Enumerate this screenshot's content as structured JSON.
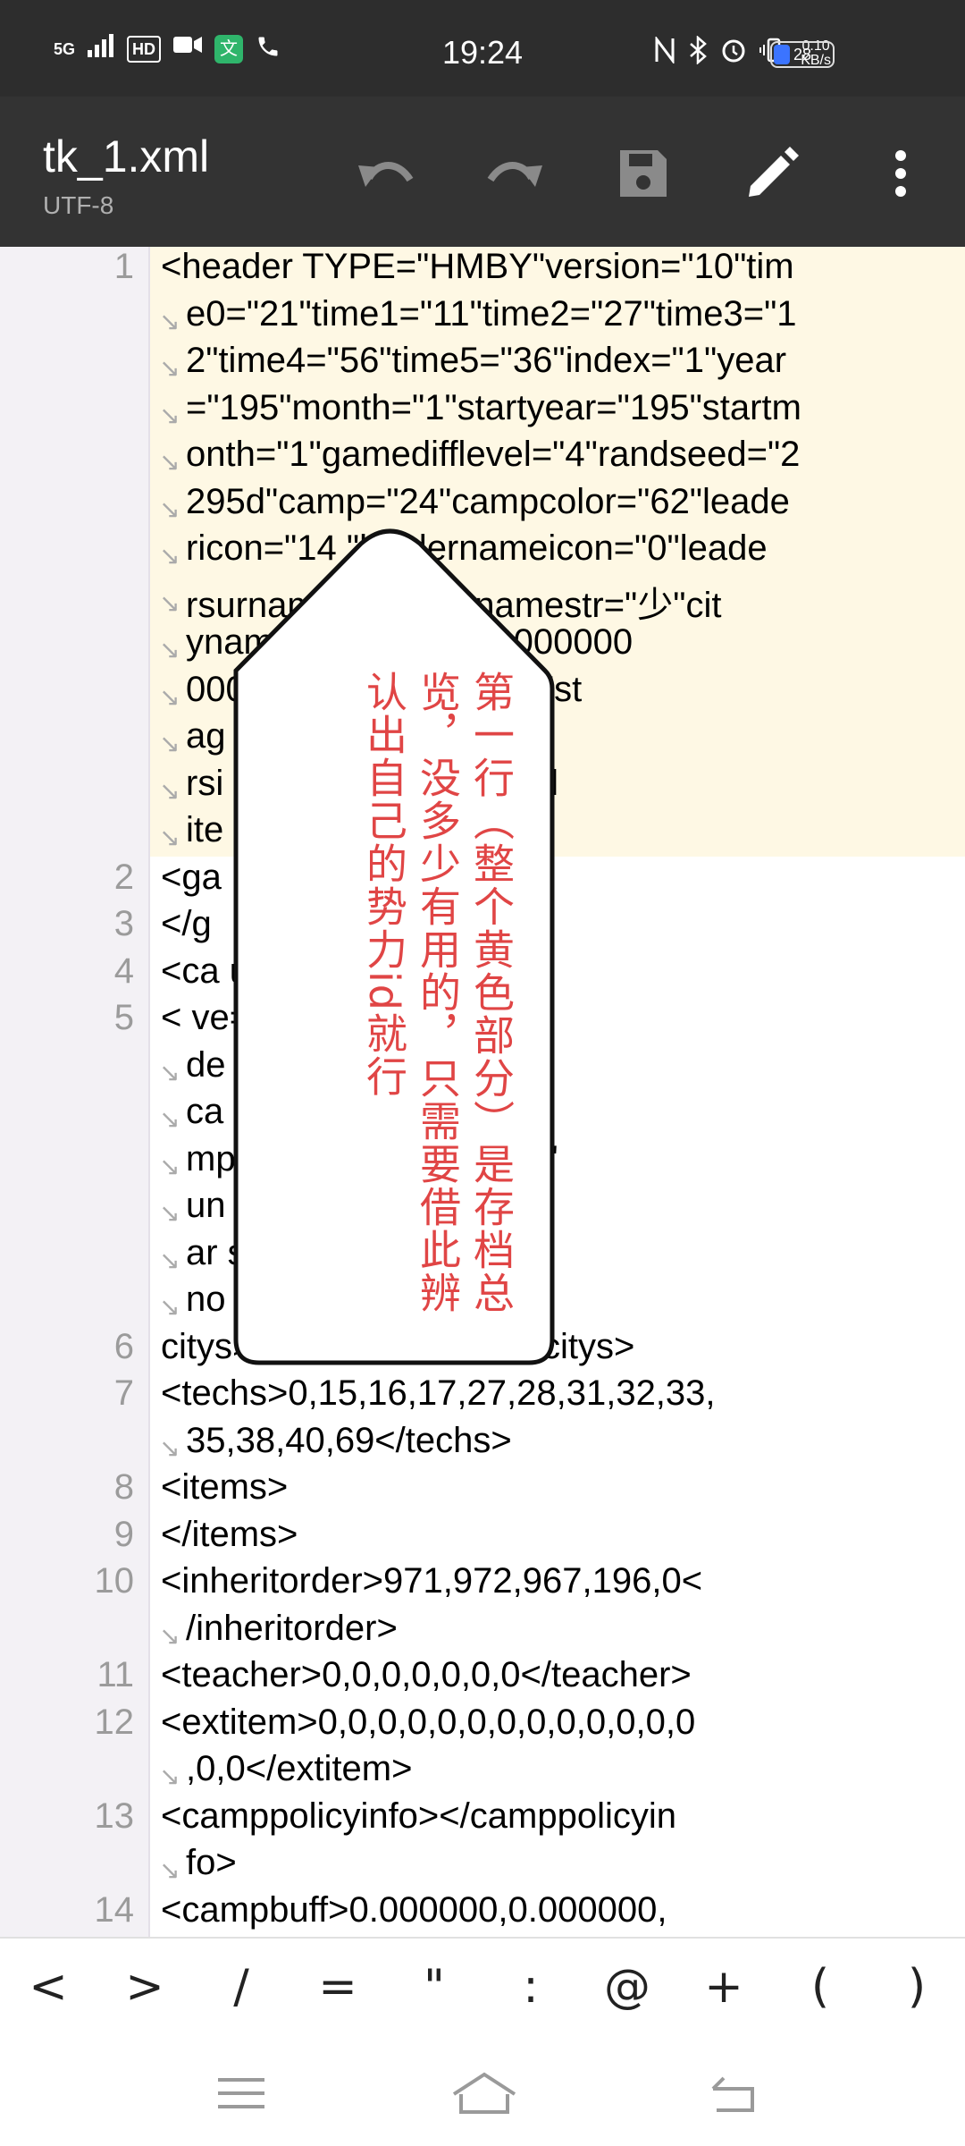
{
  "status_bar": {
    "signal": "5G",
    "hd": "HD",
    "app_badge": "文",
    "time": "19:24",
    "speed_value": "0.10",
    "speed_unit": "KB/s",
    "battery": "28",
    "battery_level": 0.28
  },
  "toolbar": {
    "file_name": "tk_1.xml",
    "encoding": "UTF-8"
  },
  "editor": {
    "line_numbers": [
      "1",
      "2",
      "3",
      "4",
      "5",
      "6",
      "7",
      "8",
      "9",
      "10",
      "11",
      "12",
      "13",
      "14"
    ],
    "code_lines": [
      "<header  TYPE=\"HMBY\"version=\"10\"tim",
      "e0=\"21\"time1=\"11\"time2=\"27\"time3=\"1",
      "2\"time4=\"56\"time5=\"36\"index=\"1\"year",
      "=\"195\"month=\"1\"startyear=\"195\"startm",
      "onth=\"1\"gamedifflevel=\"4\"randseed=\"2",
      "295d\"camp=\"24\"campcolor=\"62\"leade",
      "ricon=\"14        \"leadernameicon=\"0\"leade",
      "rsurnam              嬴\"leadernamestr=\"少\"cit",
      "ynam                   userid=\"00000000000",
      "000                     =\"02qunxionggeju\"st",
      "ag                       b0794c230\"stageve",
      "rsi                      age=\"1\"iswidow=\"1\"l",
      "ite                          >",
      "<ga",
      "</g",
      "<ca                         unt=\"47\">",
      "    <                       ve=\"1\"color=\"48\"lea",
      "de                          m=\"359\"gov=\"908\"",
      "ca                           techschedule=\"0\"ca",
      "mp                          ologyorderType=\"4\"",
      "un                           contryid=\"0\"campSt",
      "ar                           size=\"0\"protectunio",
      "no",
      "                  citys>0,5,7,8,10,71,72</citys>",
      "                <techs>0,15,16,17,27,28,31,32,33,",
      "35,38,40,69</techs>",
      "                <items>",
      "                </items>",
      "                <inheritorder>971,972,967,196,0<",
      "/inheritorder>",
      "                <teacher>0,0,0,0,0,0,0</teacher>",
      "                <extitem>0,0,0,0,0,0,0,0,0,0,0,0,0",
      ",0,0</extitem>",
      "                <camppolicyinfo></camppolicyin",
      "fo>",
      "                <campbuff>0.000000,0.000000,"
    ],
    "wrap_arrow": "↘"
  },
  "overlay_note": "第一行（整个黄色部分）是存档总览，没多少有用的，只需要借此辨认出自己的势力id就行",
  "symbol_bar": {
    "keys": [
      "<",
      ">",
      "/",
      "=",
      "\"",
      ":",
      "@",
      "+",
      "(",
      ")"
    ]
  }
}
